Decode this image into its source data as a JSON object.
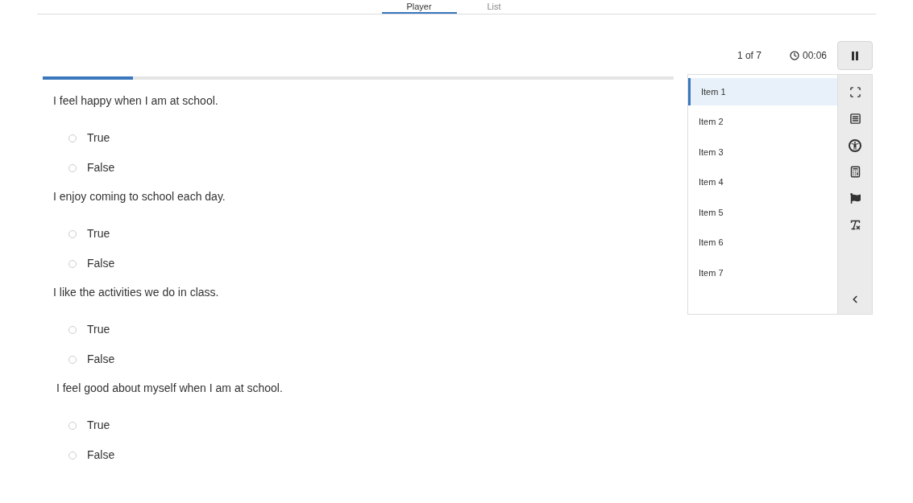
{
  "tabs": [
    {
      "label": "Player",
      "selected": true
    },
    {
      "label": "List",
      "selected": false
    }
  ],
  "header": {
    "position": "1 of 7",
    "timer": "00:06"
  },
  "progress": {
    "level": 0.143
  },
  "questions": [
    {
      "prompt": "I feel happy when I am at school.",
      "options": [
        {
          "label": "True",
          "selected": false
        },
        {
          "label": "False",
          "selected": false
        }
      ]
    },
    {
      "prompt": "I enjoy coming to school each day.",
      "options": [
        {
          "label": "True",
          "selected": false
        },
        {
          "label": "False",
          "selected": false
        }
      ]
    },
    {
      "prompt": "I like the activities we do in class.",
      "options": [
        {
          "label": "True",
          "selected": false
        },
        {
          "label": "False",
          "selected": false
        }
      ]
    },
    {
      "prompt": " I feel good about myself when I am at school.",
      "options": [
        {
          "label": "True",
          "selected": false
        },
        {
          "label": "False",
          "selected": false
        }
      ]
    }
  ],
  "sidebar": {
    "items": [
      {
        "label": "Item 1",
        "selected": true
      },
      {
        "label": "Item 2",
        "selected": false
      },
      {
        "label": "Item 3",
        "selected": false
      },
      {
        "label": "Item 4",
        "selected": false
      },
      {
        "label": "Item 5",
        "selected": false
      },
      {
        "label": "Item 6",
        "selected": false
      },
      {
        "label": "Item 7",
        "selected": false
      }
    ]
  }
}
